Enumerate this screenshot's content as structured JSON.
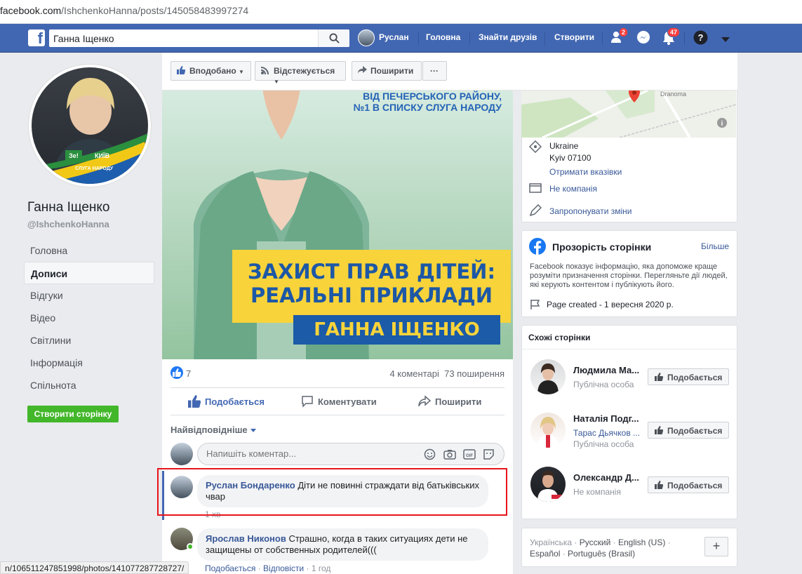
{
  "browser": {
    "url_host": "facebook.com",
    "url_path": "/IshchenkoHanna/posts/145058483997274"
  },
  "topbar": {
    "search_value": "Ганна Іщенко",
    "user_name": "Руслан",
    "nav": [
      "Головна",
      "Знайти друзів",
      "Створити"
    ],
    "friend_badge": "2",
    "notif_badge": "47"
  },
  "sidebar": {
    "page_name": "Ганна Іщенко",
    "handle": "@IshchenkoHanna",
    "items": [
      {
        "label": "Головна"
      },
      {
        "label": "Дописи"
      },
      {
        "label": "Відгуки"
      },
      {
        "label": "Відео"
      },
      {
        "label": "Світлини"
      },
      {
        "label": "Інформація"
      },
      {
        "label": "Спільнота"
      }
    ],
    "create_page_label": "Створити сторінку"
  },
  "action_bar": {
    "liked": "Вподобано",
    "following": "Відстежується",
    "share": "Поширити",
    "more": "···"
  },
  "post": {
    "image_subtext": [
      "ВІД ПЕЧЕРСЬКОГО РАЙОНУ,",
      "№1 В СПИСКУ СЛУГА НАРОДУ"
    ],
    "image_headline": [
      "ЗАХИСТ ПРАВ ДІТЕЙ:",
      "РЕАЛЬНІ ПРИКЛАДИ"
    ],
    "image_name": "ГАННА ІЩЕНКО",
    "logo_ze": "Зе!",
    "logo_kyiv": "КИЇВ",
    "logo_sluha": "СЛУГА НАРОДУ",
    "like_count": "7",
    "comments_count": "4 коментарі",
    "shares_count": "73 поширення",
    "actions": {
      "like": "Подобається",
      "comment": "Коментувати",
      "share": "Поширити"
    },
    "sort_label": "Найвідповідніше",
    "comment_placeholder": "Напишіть коментар..."
  },
  "comments": [
    {
      "author": "Руслан Бондаренко",
      "text": "Діти не повинні страждати від батьківських чвар",
      "time": "1 хв"
    },
    {
      "author": "Ярослав Никонов",
      "text": "Страшно, когда в таких ситуациях дети не защищены от собственных родителей(((",
      "like": "Подобається",
      "reply": "Відповісти",
      "time": "1 год"
    }
  ],
  "status_bar_url": "n/106511247851998/photos/141077287728727/",
  "info_card": {
    "map_label": "Dranoma",
    "country": "Ukraine",
    "city": "Kyiv 07100",
    "directions": "Отримати вказівки",
    "not_business": "Не компанія",
    "suggest_edits": "Запропонувати зміни"
  },
  "transparency": {
    "title": "Прозорість сторінки",
    "more": "Більше",
    "description": "Facebook показує інформацію, яка допоможе краще розуміти призначення сторінки. Перегляньте дії людей, які керують контентом і публікують його.",
    "created": "Page created - 1 вересня 2020 р."
  },
  "similar": {
    "title": "Схожі сторінки",
    "like_label": "Подобається",
    "pages": [
      {
        "name": "Людмила Ма...",
        "sub1": "",
        "sub2": "Публічна особа"
      },
      {
        "name": "Наталія Подг...",
        "sub1": "Тарас Дьячков ...",
        "sub2": "Публічна особа"
      },
      {
        "name": "Олександр Д...",
        "sub1": "",
        "sub2": "Не компанія"
      }
    ]
  },
  "languages": {
    "line1": [
      "Українська",
      "Русский",
      "English (US)"
    ],
    "line2": [
      "Español",
      "Português (Brasil)"
    ],
    "plus": "+"
  },
  "colors": {
    "fb_blue": "#4267b2",
    "link": "#385898",
    "green": "#42b72a",
    "highlight": "#e8141b"
  }
}
